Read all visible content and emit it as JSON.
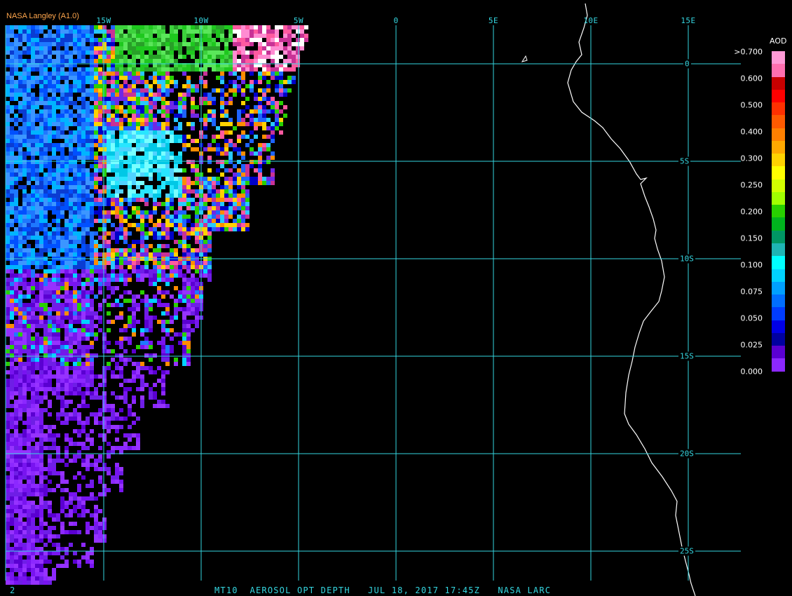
{
  "header": {
    "source_label": "NASA Langley (A1.0)"
  },
  "map": {
    "longitude_labels": [
      "15W",
      "10W",
      "5W",
      "0",
      "5E",
      "10E",
      "15E"
    ],
    "latitude_labels": [
      "0",
      "5S",
      "10S",
      "15S",
      "20S",
      "25S"
    ],
    "grid_color": "#35d6e0",
    "coastline_color": "#ffffff",
    "background_color": "#000000"
  },
  "legend": {
    "title": "AOD",
    "ticks": [
      ">0.700",
      "0.600",
      "0.500",
      "0.400",
      "0.300",
      "0.250",
      "0.200",
      "0.150",
      "0.100",
      "0.075",
      "0.050",
      "0.025",
      "0.000"
    ],
    "colors": [
      "#ff99d6",
      "#ff6fb0",
      "#c80000",
      "#ff0000",
      "#ff3000",
      "#ff5a00",
      "#ff8000",
      "#ffa800",
      "#ffd200",
      "#ffff00",
      "#d2ff00",
      "#a0ff00",
      "#28d000",
      "#00b41e",
      "#009664",
      "#1eb4b4",
      "#00ffff",
      "#00d2ff",
      "#00a0ff",
      "#006eff",
      "#003cff",
      "#0000e6",
      "#0000a0",
      "#5a00d2",
      "#8c28ff"
    ]
  },
  "footer": {
    "left_mark": "2",
    "caption": "MT10  AEROSOL OPT DEPTH   JUL 18, 2017 17:45Z   NASA LARC"
  }
}
